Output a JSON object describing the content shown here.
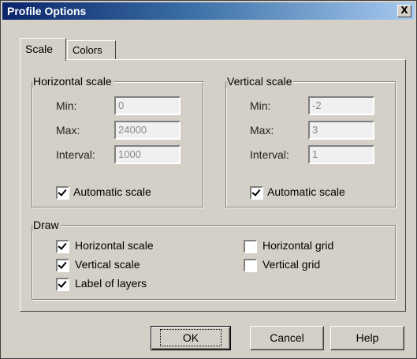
{
  "window": {
    "title": "Profile Options",
    "close_label": "X"
  },
  "tabs": [
    {
      "label": "Scale"
    },
    {
      "label": "Colors"
    }
  ],
  "horizontal_scale": {
    "legend": "Horizontal scale",
    "min_label": "Min:",
    "min_value": "0",
    "max_label": "Max:",
    "max_value": "24000",
    "interval_label": "Interval:",
    "interval_value": "1000",
    "automatic_label": "Automatic scale",
    "automatic_checked": true
  },
  "vertical_scale": {
    "legend": "Vertical scale",
    "min_label": "Min:",
    "min_value": "-2",
    "max_label": "Max:",
    "max_value": "3",
    "interval_label": "Interval:",
    "interval_value": "1",
    "automatic_label": "Automatic scale",
    "automatic_checked": true
  },
  "draw": {
    "legend": "Draw",
    "options": [
      {
        "label": "Horizontal scale",
        "checked": true
      },
      {
        "label": "Vertical scale",
        "checked": true
      },
      {
        "label": "Label of layers",
        "checked": true
      },
      {
        "label": "Horizontal grid",
        "checked": false
      },
      {
        "label": "Vertical grid",
        "checked": false
      }
    ]
  },
  "buttons": {
    "ok": "OK",
    "cancel": "Cancel",
    "help": "Help"
  }
}
